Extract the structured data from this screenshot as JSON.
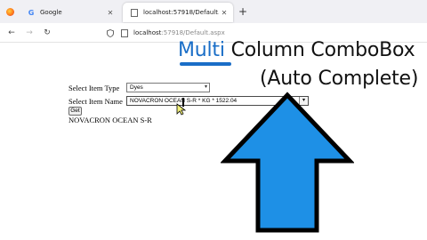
{
  "browser": {
    "tabs": [
      {
        "title": "Google",
        "active": false,
        "favicon": "google-g-icon"
      },
      {
        "title": "localhost:57918/Default.aspx",
        "active": true,
        "favicon": "page-icon"
      }
    ],
    "url_host": "localhost",
    "url_rest": ":57918/Default.aspx"
  },
  "form": {
    "select_item_type_label": "Select Item Type",
    "select_item_type_value": "Dyes",
    "select_item_name_label": "Select Item Name",
    "select_item_name_value": "NOVACRON OCEAN S-R * KG * 1522.04",
    "get_button_label": "Get",
    "result_text": "NOVACRON OCEAN S-R"
  },
  "overlay": {
    "headline_word_highlight": "Multi",
    "headline_rest_line1": " Column ComboBox",
    "headline_line2": "(Auto Complete)",
    "accent_color": "#1a6ec7",
    "arrow_fill": "#1e90e6"
  }
}
